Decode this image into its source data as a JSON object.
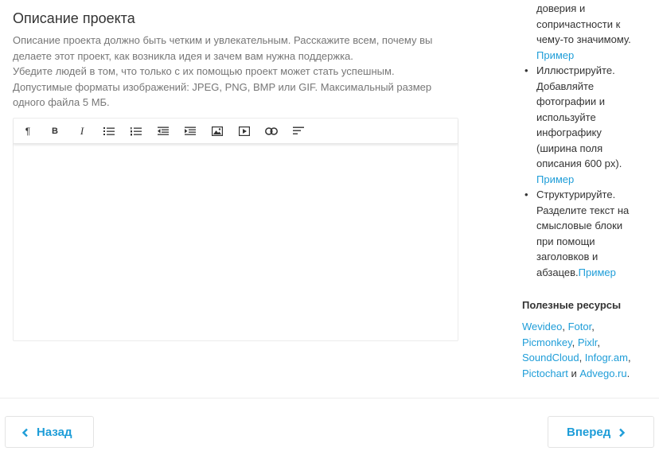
{
  "section": {
    "title": "Описание проекта",
    "description_lines": [
      "Описание проекта должно быть четким и увлекательным. Расскажите всем, почему вы",
      "делаете этот проект, как возникла идея и зачем вам нужна поддержка.",
      "Убедите людей в том, что только с их помощью проект может стать успешным.",
      "Допустимые форматы изображений: JPEG, PNG, BMP или GIF. Максимальный размер",
      "одного файла 5 МБ."
    ]
  },
  "toolbar": {
    "paragraph": "¶",
    "bold": "B",
    "italic": "I"
  },
  "sidebar": {
    "top_cont_lines": [
      "доверия и",
      "сопричастности к",
      "чему-то значимому."
    ],
    "top_example": "Пример",
    "tips": [
      {
        "lines": [
          "Иллюстрируйте.",
          "Добавляйте",
          "фотографии и",
          "используйте",
          "инфографику",
          "(ширина поля",
          "описания 600 px)."
        ],
        "example": "Пример"
      },
      {
        "lines": [
          "Структурируйте.",
          "Разделите текст на",
          "смысловые блоки",
          "при помощи",
          "заголовков и",
          "абзацев."
        ],
        "example": "Пример"
      }
    ],
    "resources_title": "Полезные ресурсы",
    "resources": {
      "wevideo": "Wevideo",
      "fotor": "Fotor",
      "picmonkey": "Picmonkey",
      "pixlr": "Pixlr",
      "soundcloud": "SoundCloud",
      "infogram": "Infogr.am",
      "pictochart": "Pictochart",
      "and": "и",
      "advego": "Advego.ru"
    }
  },
  "nav": {
    "back_label": "Назад",
    "next_label": "Вперед"
  },
  "colors": {
    "link": "#1e9dd8",
    "muted_text": "#777777"
  }
}
